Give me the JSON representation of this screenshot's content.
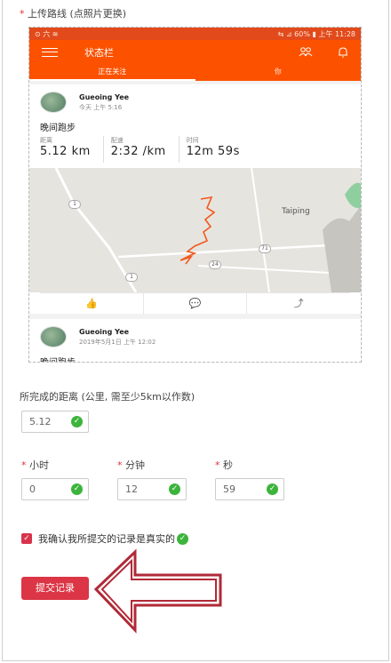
{
  "upload": {
    "required_mark": "*",
    "label": "上传路线 (点照片更换)"
  },
  "screenshot": {
    "statusbar": {
      "left": "⊙ 六 ≋",
      "right": "⇆ ⊿ 60% ▮ 上午 11:28"
    },
    "appbar": {
      "title": "状态栏"
    },
    "tabs": [
      "正在关注",
      "你"
    ],
    "card1": {
      "name": "Gueoing Yee",
      "time": "今天 上午 5:16",
      "activity": "晚间跑步",
      "stats": [
        {
          "label": "距离",
          "value": "5.12 km"
        },
        {
          "label": "配速",
          "value": "2:32 /km"
        },
        {
          "label": "时间",
          "value": "12m 59s"
        }
      ],
      "map": {
        "town": "Taiping",
        "shields": [
          "1",
          "24",
          "71",
          "1"
        ]
      }
    },
    "actions": [
      "👍",
      "💬",
      "⤴"
    ],
    "card2": {
      "name": "Gueoing Yee",
      "time": "2019年5月1日 上午 12:02",
      "activity": "晚间跑步"
    }
  },
  "form": {
    "distance": {
      "label": "所完成的距离 (公里, 需至少5km以作数)",
      "value": "5.12"
    },
    "hours": {
      "required_mark": "*",
      "label": "小时",
      "value": "0"
    },
    "minutes": {
      "required_mark": "*",
      "label": "分钟",
      "value": "12"
    },
    "seconds": {
      "required_mark": "*",
      "label": "秒",
      "value": "59"
    },
    "check_glyph": "✓",
    "confirm": {
      "checkbox_glyph": "✓",
      "text": "我确认我所提交的记录是真实的"
    },
    "submit_label": "提交记录"
  },
  "colors": {
    "strava_orange": "#fc5200",
    "required_red": "#e0303a",
    "submit_red": "#dc3545",
    "valid_green": "#3cb43c",
    "arrow_red": "#b02a37"
  },
  "icons": {
    "arrow": "left-pointing-outline-arrow-icon",
    "valid": "checkmark-circle-icon"
  }
}
